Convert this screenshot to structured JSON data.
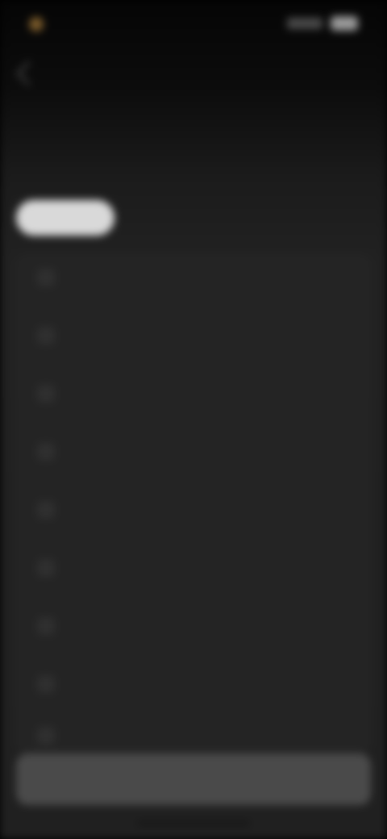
{
  "status_bar": {
    "time": " ",
    "signal_icon": "signal-icon",
    "battery_icon": "battery-icon"
  },
  "header": {
    "back_icon": "chevron-left-icon",
    "title": " "
  },
  "section": {
    "label": " ",
    "action_label": " "
  },
  "tabs": [
    {
      "label": " ",
      "active": true
    },
    {
      "label": " ",
      "active": false
    }
  ],
  "list": {
    "items": [
      {
        "label": " "
      },
      {
        "label": " "
      },
      {
        "label": " "
      },
      {
        "label": " "
      },
      {
        "label": " "
      },
      {
        "label": " "
      },
      {
        "label": " "
      },
      {
        "label": " "
      },
      {
        "label": " "
      }
    ]
  },
  "bottom_bar": {
    "button_label": " "
  },
  "colors": {
    "background": "#202020",
    "card": "#242424",
    "active_tab": "#d9d9d9",
    "bottom_bar": "#4a4a4a"
  }
}
